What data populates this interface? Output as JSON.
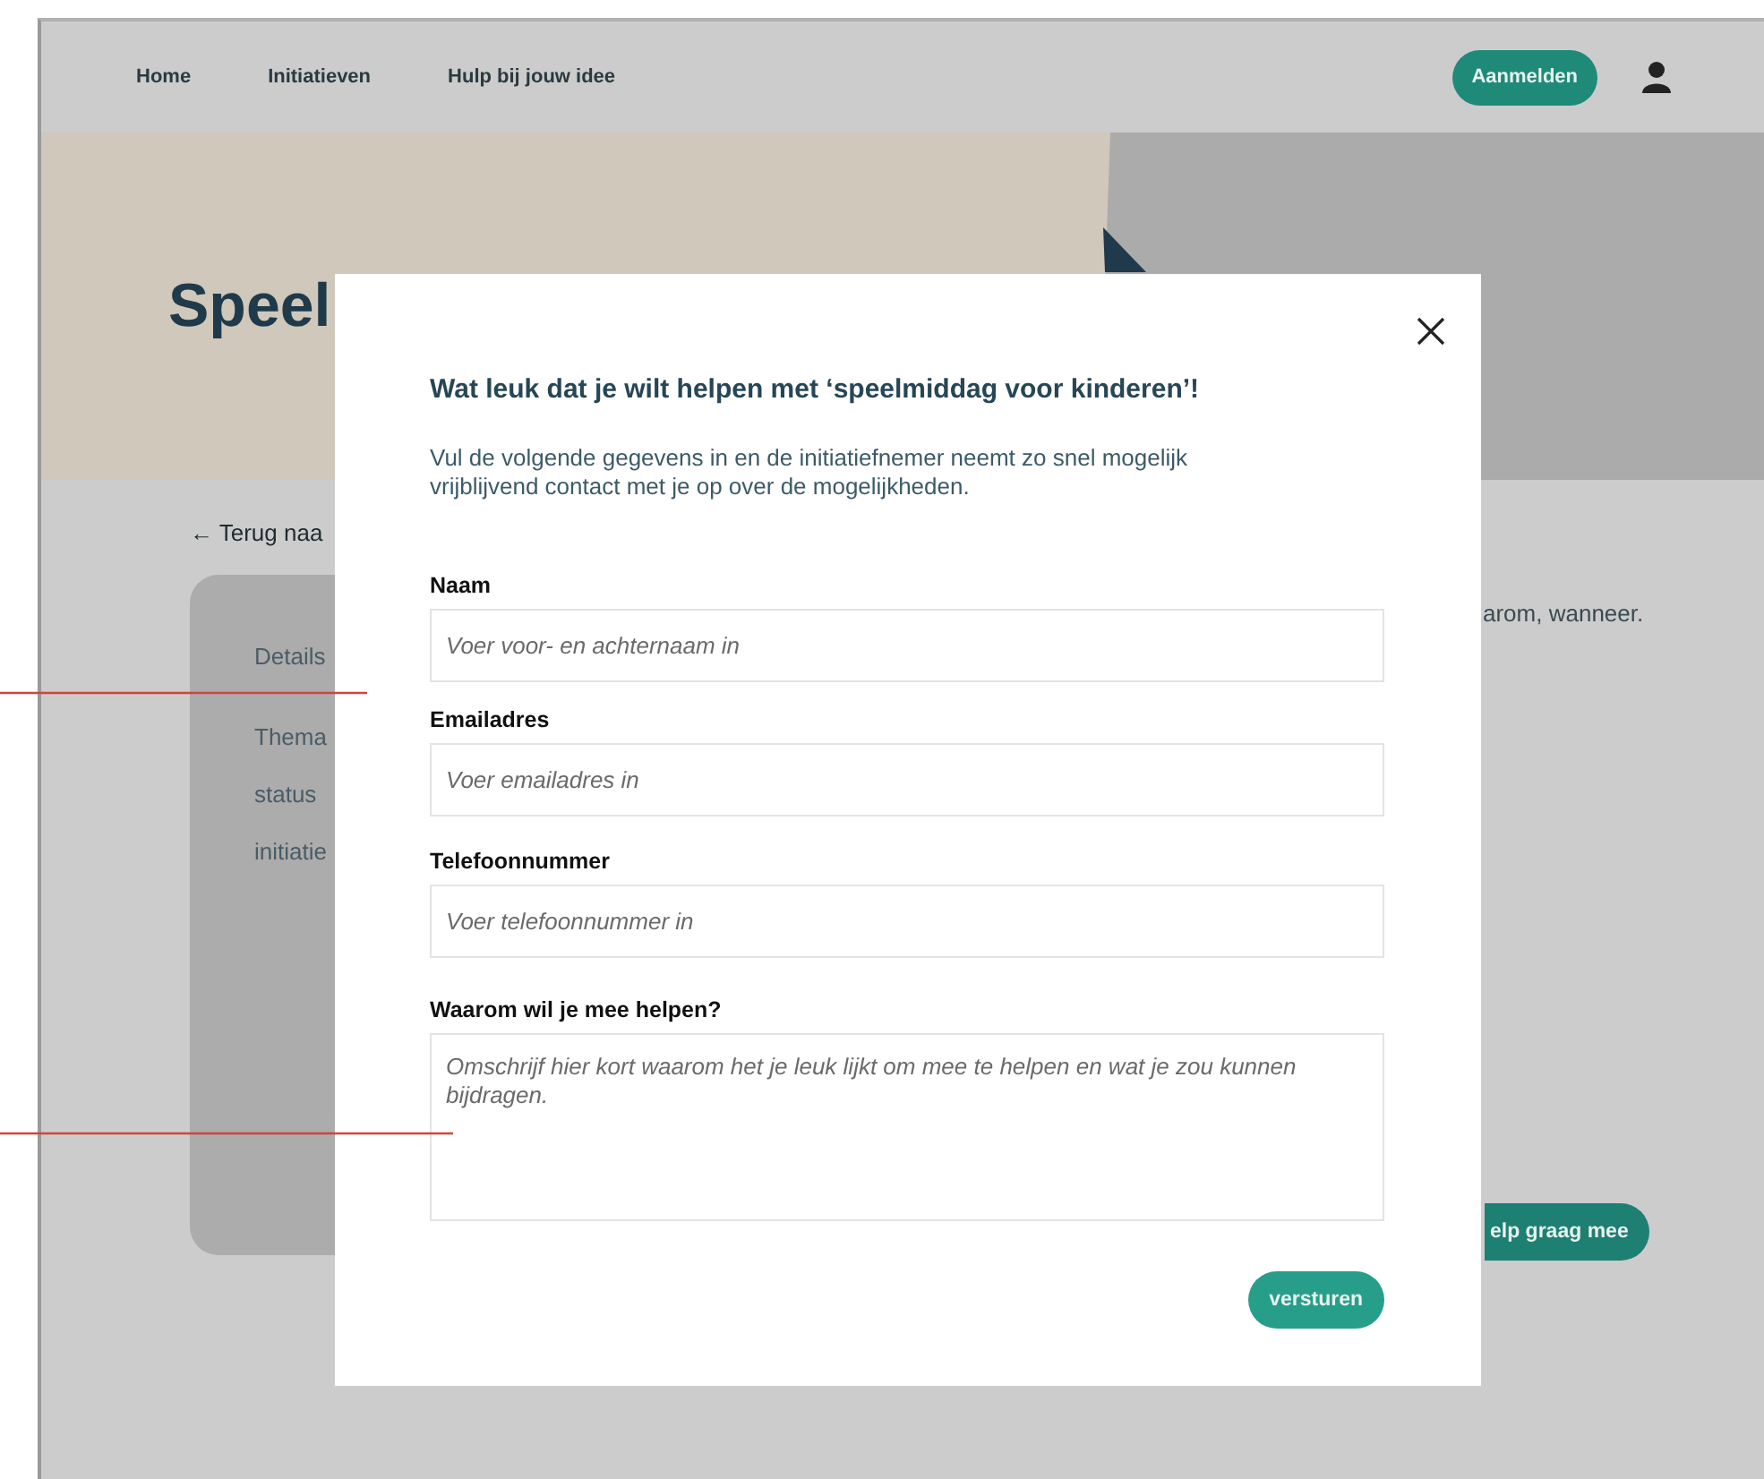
{
  "nav": {
    "links": [
      "Home",
      "Initiatieven",
      "Hulp bij jouw idee"
    ],
    "login_button": "Aanmelden"
  },
  "hero": {
    "title": "Speel"
  },
  "back_link": "← Terug naa",
  "details_card": {
    "heading": "Details",
    "rows": [
      "Thema",
      "status",
      "initiatie"
    ]
  },
  "side_text": "arom, wanneer.",
  "help_button": "elp graag mee",
  "modal": {
    "title": "Wat leuk dat je wilt helpen met ‘speelmiddag voor kinderen’!",
    "intro": "Vul de volgende gegevens in en de initiatiefnemer neemt zo snel mogelijk vrijblijvend contact met je op over de mogelijkheden.",
    "fields": [
      {
        "label": "Naam",
        "placeholder": "Voer voor- en achternaam in",
        "kind": "input"
      },
      {
        "label": "Emailadres",
        "placeholder": "Voer emailadres in",
        "kind": "input"
      },
      {
        "label": "Telefoonnummer",
        "placeholder": "Voer telefoonnummer in",
        "kind": "input"
      },
      {
        "label": "Waarom wil je mee helpen?",
        "placeholder": "Omschrijf hier kort waarom het je leuk lijkt om mee te helpen en wat je zou kunnen bijdragen.",
        "kind": "textarea"
      }
    ],
    "submit": "versturen"
  }
}
